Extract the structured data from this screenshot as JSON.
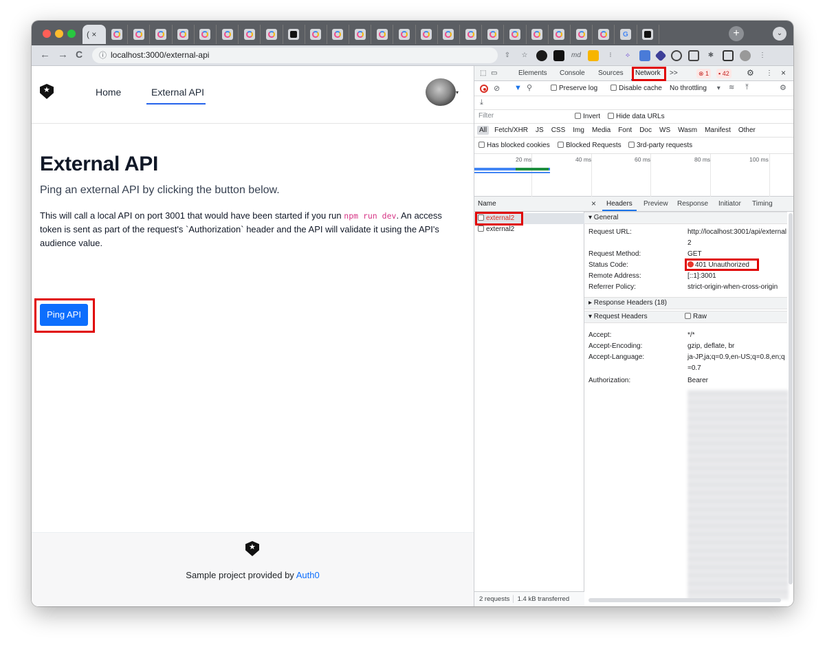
{
  "browser": {
    "tab_title": "( ×",
    "tab_close": "×",
    "new_tab": "+",
    "tab_menu": "⌄",
    "url_host": "localhost",
    "url_rest": ":3000/external-api",
    "back": "←",
    "forward": "→",
    "reload": "C",
    "omni_info": "ⓘ"
  },
  "app": {
    "nav": {
      "home": "Home",
      "external_api": "External API"
    },
    "avatar_caret": "▾",
    "title": "External API",
    "lead": "Ping an external API by clicking the button below.",
    "body_pre": "This will call a local API on port 3001 that would have been started if you run ",
    "body_code": "npm run dev",
    "body_post": ". An access token is sent as part of the request's `Authorization` header and the API will validate it using the API's audience value.",
    "ping_button": "Ping API",
    "footer_pre": "Sample project provided by ",
    "footer_link": "Auth0"
  },
  "devtools": {
    "tabs": [
      "Elements",
      "Console",
      "Sources",
      "Network"
    ],
    "more": ">>",
    "error_count": "1",
    "warning_count": "42",
    "close": "×",
    "menu": "⋮",
    "toolbar": {
      "preserve_log": "Preserve log",
      "disable_cache": "Disable cache",
      "throttling": "No throttling",
      "throttle_arrow": "▾"
    },
    "download": "⤓",
    "filter": {
      "placeholder": "Filter",
      "invert": "Invert",
      "hide_data_urls": "Hide data URLs",
      "types": [
        "All",
        "Fetch/XHR",
        "JS",
        "CSS",
        "Img",
        "Media",
        "Font",
        "Doc",
        "WS",
        "Wasm",
        "Manifest",
        "Other"
      ],
      "has_blocked_cookies": "Has blocked cookies",
      "blocked_requests": "Blocked Requests",
      "third_party": "3rd-party requests"
    },
    "timeline_ticks": [
      "20 ms",
      "40 ms",
      "60 ms",
      "80 ms",
      "100 ms"
    ],
    "list": {
      "header": "Name",
      "rows": [
        "external2",
        "external2"
      ],
      "status_requests": "2 requests",
      "status_transferred": "1.4 kB transferred"
    },
    "detail": {
      "close": "×",
      "tabs": [
        "Headers",
        "Preview",
        "Response",
        "Initiator",
        "Timing"
      ],
      "general": {
        "title": "▾ General",
        "request_url_k": "Request URL:",
        "request_url_v": "http://localhost:3001/api/external2",
        "method_k": "Request Method:",
        "method_v": "GET",
        "status_k": "Status Code:",
        "status_v": "401 Unauthorized",
        "remote_k": "Remote Address:",
        "remote_v": "[::1]:3001",
        "referrer_k": "Referrer Policy:",
        "referrer_v": "strict-origin-when-cross-origin"
      },
      "response_headers": "▸ Response Headers (18)",
      "request_headers": "▾ Request Headers",
      "raw": "Raw",
      "req": {
        "accept_k": "Accept:",
        "accept_v": "*/*",
        "encoding_k": "Accept-Encoding:",
        "encoding_v": "gzip, deflate, br",
        "language_k": "Accept-Language:",
        "language_v": "ja-JP,ja;q=0.9,en-US;q=0.8,en;q=0.7",
        "auth_k": "Authorization:",
        "auth_v": "Bearer"
      }
    }
  },
  "colors": {
    "accent": "#0d6efd",
    "highlight": "#e00000",
    "error": "#d93025",
    "devtools_active": "#1a73e8"
  }
}
